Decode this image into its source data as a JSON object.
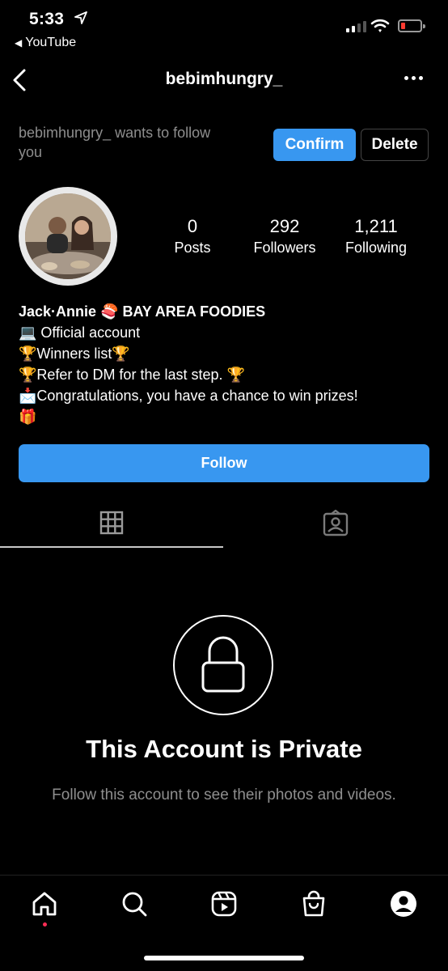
{
  "status_bar": {
    "time": "5:33",
    "back_app": "YouTube",
    "signal_bars": 2,
    "battery_level_percent": 10
  },
  "header": {
    "title": "bebimhungry_"
  },
  "follow_request": {
    "text": "bebimhungry_ wants to follow you",
    "confirm_label": "Confirm",
    "delete_label": "Delete"
  },
  "stats": {
    "posts": {
      "value": "0",
      "label": "Posts"
    },
    "followers": {
      "value": "292",
      "label": "Followers"
    },
    "following": {
      "value": "1,211",
      "label": "Following"
    }
  },
  "bio": {
    "name": "Jack·Annie 🍣 BAY AREA FOODIES",
    "lines": [
      "💻 Official account",
      "🏆Winners list🏆",
      "🏆Refer to DM for the last step. 🏆",
      "📩Congratulations, you have a chance to win prizes!",
      "🎁"
    ]
  },
  "follow_button": {
    "label": "Follow"
  },
  "private": {
    "title": "This Account is Private",
    "subtitle": "Follow this account to see their photos and videos."
  },
  "colors": {
    "background": "#000000",
    "accent": "#3897f0",
    "muted_text": "#8e8e8e",
    "notification_dot": "#ff2d55"
  },
  "icons": {
    "bottom_nav": [
      "home-icon",
      "search-icon",
      "reels-icon",
      "shop-icon",
      "profile-icon"
    ],
    "tabs": [
      "grid-icon",
      "tagged-icon"
    ]
  }
}
